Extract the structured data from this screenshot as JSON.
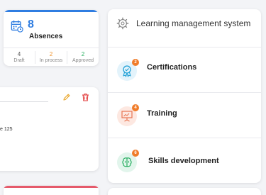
{
  "absences": {
    "count": "8",
    "label": "Absences",
    "accent": "#2f7de1",
    "icon": "calendar-clock-icon",
    "stats": [
      {
        "value": "4",
        "label": "Draft",
        "color": "#555555"
      },
      {
        "value": "2",
        "label": "In process",
        "color": "#f0932b"
      },
      {
        "value": "2",
        "label": "Approved",
        "color": "#27ae60"
      }
    ]
  },
  "detail": {
    "text": "e 125",
    "edit_icon": "pencil-icon",
    "delete_icon": "trash-icon"
  },
  "red_card": {
    "accent": "#e55a6b"
  },
  "lms": {
    "title": "Learning management system",
    "icon": "gear-icon",
    "items": [
      {
        "label": "Certifications",
        "badge": "2",
        "icon": "ribbon-icon",
        "bg": "#e3f3fb",
        "color": "#1fa0d6",
        "badge_color": "#f07c2a"
      },
      {
        "label": "Training",
        "badge": "4",
        "icon": "presentation-icon",
        "bg": "#fde8e1",
        "color": "#e87552",
        "badge_color": "#f07c2a"
      },
      {
        "label": "Skills development",
        "badge": "6",
        "icon": "brain-icon",
        "bg": "#e2f5ec",
        "color": "#27ae60",
        "badge_color": "#f07c2a"
      }
    ]
  }
}
